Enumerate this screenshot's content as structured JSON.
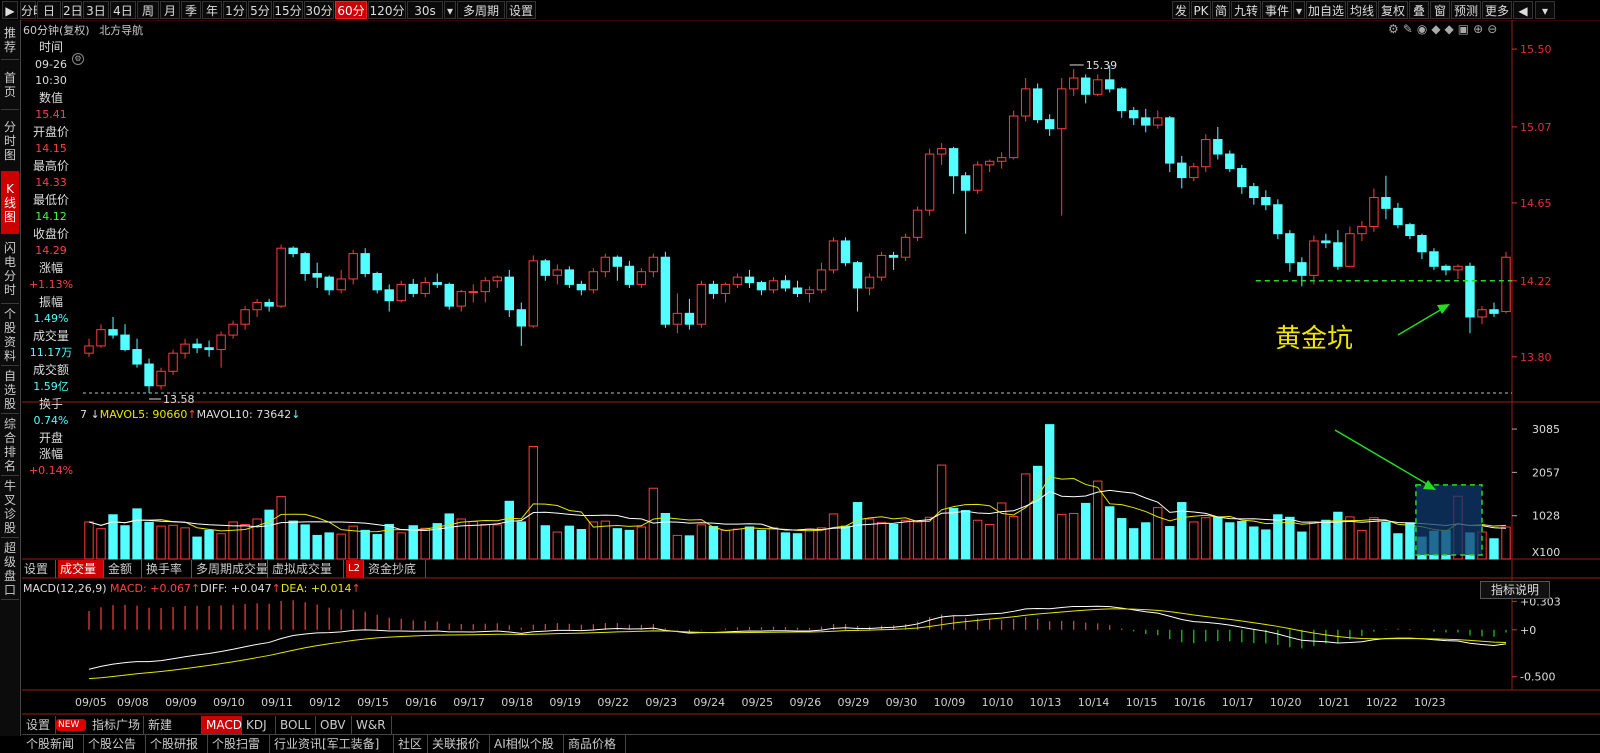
{
  "toolbar": {
    "left": [
      "分时",
      "日",
      "2日",
      "3日",
      "4日",
      "周",
      "月",
      "季",
      "年",
      "1分",
      "5分",
      "15分",
      "30分",
      "60分",
      "120分",
      "30s",
      "多周期",
      "设置"
    ],
    "active": "60分",
    "right": [
      "发",
      "PK",
      "简",
      "九转",
      "事件",
      "加自选",
      "均线",
      "复权",
      "叠",
      "窗",
      "预测",
      "更多"
    ]
  },
  "leftnav": [
    "推荐",
    "首页",
    "分时图",
    "K线图",
    "闪电分时",
    "个股资料",
    "自选股",
    "综合排名",
    "牛叉诊股",
    "超级盘口"
  ],
  "leftnav_active": "K线图",
  "header": {
    "period": "60分钟(复权)",
    "stock": "北方导航"
  },
  "info": {
    "time_label": "时间",
    "date": "09-26",
    "time": "10:30",
    "value_label": "数值",
    "value": "15.41",
    "open_label": "开盘价",
    "open": "14.15",
    "high_label": "最高价",
    "high": "14.33",
    "low_label": "最低价",
    "low": "14.12",
    "close_label": "收盘价",
    "close": "14.29",
    "change_label": "涨幅",
    "change": "+1.13%",
    "amplitude_label": "振幅",
    "amplitude": "1.49%",
    "volume_label": "成交量",
    "volume": "11.17万",
    "amount_label": "成交额",
    "amount": "1.59亿",
    "turnover_label": "换手",
    "turnover": "0.74%",
    "open_change_label1": "开盘",
    "open_change_label2": "涨幅",
    "open_change": "+0.14%"
  },
  "volume_legend": {
    "prefix": "7",
    "mavol5_label": "MAVOL5:",
    "mavol5": "90660",
    "mavol10_label": "MAVOL10:",
    "mavol10": "73642"
  },
  "macd_legend": {
    "title": "MACD(12,26,9)",
    "macd_label": "MACD:",
    "macd": "+0.067",
    "diff_label": "DIFF:",
    "diff": "+0.047",
    "dea_label": "DEA:",
    "dea": "+0.014"
  },
  "indicator_button": "指标说明",
  "tabs": [
    "设置",
    "成交量",
    "金额",
    "换手率",
    "多周期成交量",
    "虚拟成交量",
    "L2",
    "资金抄底"
  ],
  "tab_active": "成交量",
  "bottombar": [
    "设置",
    "NEW",
    "指标广场",
    "新建",
    "MACD",
    "KDJ",
    "BOLL",
    "OBV",
    "W&R"
  ],
  "bottombar_active": "MACD",
  "newsbar": [
    "个股新闻",
    "个股公告",
    "个股研报",
    "个股扫雷",
    "行业资讯[军工装备]",
    "社区",
    "关联报价",
    "AI相似个股",
    "商品价格"
  ],
  "annotation": {
    "text": "黄金坑",
    "color": "#f2e600",
    "arrow_color": "#22dd22",
    "line_color": "#22dd22"
  },
  "colors": {
    "up": "#ff3b3b",
    "down": "#54ffff",
    "ma5": "#e6e600",
    "ma10": "#ffffff",
    "axis_red": "#e03030",
    "date": "#d0d0d0"
  },
  "chart_data": [
    {
      "type": "candlestick",
      "yaxis": {
        "ticks": [
          15.5,
          15.07,
          14.65,
          14.22,
          13.8
        ],
        "ylim": [
          13.6,
          15.55
        ]
      },
      "x_date_labels": [
        "09/05",
        "09/08",
        "09/09",
        "09/10",
        "09/11",
        "09/12",
        "09/15",
        "09/16",
        "09/17",
        "09/18",
        "09/19",
        "09/22",
        "09/23",
        "09/24",
        "09/25",
        "09/26",
        "09/29",
        "09/30",
        "10/09",
        "10/10",
        "10/13",
        "10/14",
        "10/15",
        "10/16",
        "10/17",
        "10/20",
        "10/21",
        "10/22",
        "10/23"
      ],
      "bars_per_day": 4,
      "ohlc": [
        [
          13.82,
          13.9,
          13.8,
          13.86
        ],
        [
          13.86,
          13.98,
          13.85,
          13.95
        ],
        [
          13.95,
          14.02,
          13.9,
          13.92
        ],
        [
          13.92,
          13.98,
          13.83,
          13.84
        ],
        [
          13.84,
          13.9,
          13.74,
          13.76
        ],
        [
          13.76,
          13.79,
          13.6,
          13.64
        ],
        [
          13.64,
          13.74,
          13.62,
          13.72
        ],
        [
          13.72,
          13.84,
          13.7,
          13.82
        ],
        [
          13.82,
          13.9,
          13.79,
          13.87
        ],
        [
          13.87,
          13.9,
          13.82,
          13.85
        ],
        [
          13.85,
          13.89,
          13.8,
          13.84
        ],
        [
          13.84,
          13.94,
          13.74,
          13.92
        ],
        [
          13.92,
          14.0,
          13.9,
          13.98
        ],
        [
          13.98,
          14.08,
          13.95,
          14.06
        ],
        [
          14.06,
          14.12,
          14.02,
          14.1
        ],
        [
          14.1,
          14.12,
          14.05,
          14.08
        ],
        [
          14.08,
          14.42,
          14.07,
          14.4
        ],
        [
          14.4,
          14.41,
          14.35,
          14.37
        ],
        [
          14.37,
          14.38,
          14.22,
          14.26
        ],
        [
          14.26,
          14.32,
          14.18,
          14.24
        ],
        [
          14.24,
          14.25,
          14.14,
          14.17
        ],
        [
          14.17,
          14.28,
          14.15,
          14.23
        ],
        [
          14.23,
          14.39,
          14.2,
          14.37
        ],
        [
          14.37,
          14.4,
          14.24,
          14.26
        ],
        [
          14.26,
          14.27,
          14.15,
          14.17
        ],
        [
          14.17,
          14.2,
          14.05,
          14.11
        ],
        [
          14.11,
          14.22,
          14.1,
          14.2
        ],
        [
          14.2,
          14.23,
          14.13,
          14.15
        ],
        [
          14.15,
          14.24,
          14.13,
          14.21
        ],
        [
          14.21,
          14.26,
          14.18,
          14.2
        ],
        [
          14.2,
          14.21,
          14.06,
          14.08
        ],
        [
          14.08,
          14.17,
          14.05,
          14.16
        ],
        [
          14.16,
          14.2,
          14.1,
          14.16
        ],
        [
          14.16,
          14.24,
          14.1,
          14.22
        ],
        [
          14.22,
          14.25,
          14.18,
          14.24
        ],
        [
          14.24,
          14.28,
          14.02,
          14.06
        ],
        [
          14.06,
          14.1,
          13.86,
          13.97
        ],
        [
          13.97,
          14.36,
          13.96,
          14.33
        ],
        [
          14.33,
          14.34,
          14.22,
          14.25
        ],
        [
          14.25,
          14.31,
          14.2,
          14.28
        ],
        [
          14.28,
          14.3,
          14.18,
          14.2
        ],
        [
          14.2,
          14.22,
          14.14,
          14.17
        ],
        [
          14.17,
          14.29,
          14.15,
          14.27
        ],
        [
          14.27,
          14.37,
          14.24,
          14.35
        ],
        [
          14.35,
          14.36,
          14.22,
          14.3
        ],
        [
          14.3,
          14.33,
          14.18,
          14.2
        ],
        [
          14.2,
          14.29,
          14.18,
          14.27
        ],
        [
          14.27,
          14.37,
          14.24,
          14.35
        ],
        [
          14.35,
          14.38,
          13.96,
          13.98
        ],
        [
          13.98,
          14.15,
          13.93,
          14.04
        ],
        [
          14.04,
          14.12,
          13.95,
          13.98
        ],
        [
          13.98,
          14.22,
          13.96,
          14.2
        ],
        [
          14.2,
          14.22,
          14.12,
          14.15
        ],
        [
          14.15,
          14.21,
          14.1,
          14.2
        ],
        [
          14.2,
          14.26,
          14.18,
          14.24
        ],
        [
          14.24,
          14.28,
          14.18,
          14.21
        ],
        [
          14.21,
          14.22,
          14.14,
          14.17
        ],
        [
          14.17,
          14.24,
          14.15,
          14.22
        ],
        [
          14.22,
          14.25,
          14.16,
          14.18
        ],
        [
          14.18,
          14.22,
          14.13,
          14.15
        ],
        [
          14.15,
          14.19,
          14.1,
          14.17
        ],
        [
          14.17,
          14.32,
          14.15,
          14.28
        ],
        [
          14.28,
          14.46,
          14.26,
          14.44
        ],
        [
          14.44,
          14.46,
          14.3,
          14.32
        ],
        [
          14.32,
          14.33,
          14.05,
          14.18
        ],
        [
          14.18,
          14.26,
          14.14,
          14.24
        ],
        [
          14.24,
          14.38,
          14.22,
          14.36
        ],
        [
          14.36,
          14.38,
          14.28,
          14.35
        ],
        [
          14.35,
          14.48,
          14.33,
          14.46
        ],
        [
          14.46,
          14.63,
          14.44,
          14.61
        ],
        [
          14.61,
          14.95,
          14.58,
          14.92
        ],
        [
          14.92,
          14.98,
          14.86,
          14.95
        ],
        [
          14.95,
          14.96,
          14.7,
          14.8
        ],
        [
          14.8,
          14.82,
          14.48,
          14.72
        ],
        [
          14.72,
          14.88,
          14.7,
          14.86
        ],
        [
          14.86,
          14.89,
          14.82,
          14.88
        ],
        [
          14.88,
          14.93,
          14.84,
          14.9
        ],
        [
          14.9,
          15.16,
          14.89,
          15.13
        ],
        [
          15.13,
          15.34,
          15.1,
          15.28
        ],
        [
          15.28,
          15.31,
          15.09,
          15.11
        ],
        [
          15.11,
          15.14,
          15.02,
          15.06
        ],
        [
          15.06,
          15.34,
          14.58,
          15.28
        ],
        [
          15.28,
          15.39,
          15.24,
          15.34
        ],
        [
          15.34,
          15.36,
          15.2,
          15.25
        ],
        [
          15.25,
          15.36,
          15.24,
          15.33
        ],
        [
          15.33,
          15.41,
          15.26,
          15.28
        ],
        [
          15.28,
          15.29,
          15.12,
          15.16
        ],
        [
          15.16,
          15.18,
          15.08,
          15.12
        ],
        [
          15.12,
          15.17,
          15.04,
          15.08
        ],
        [
          15.08,
          15.16,
          15.06,
          15.12
        ],
        [
          15.12,
          15.13,
          14.82,
          14.87
        ],
        [
          14.87,
          14.91,
          14.73,
          14.79
        ],
        [
          14.79,
          14.87,
          14.77,
          14.85
        ],
        [
          14.85,
          15.03,
          14.82,
          15.0
        ],
        [
          15.0,
          15.07,
          14.89,
          14.92
        ],
        [
          14.92,
          14.94,
          14.82,
          14.84
        ],
        [
          14.84,
          14.86,
          14.7,
          14.74
        ],
        [
          14.74,
          14.76,
          14.64,
          14.68
        ],
        [
          14.68,
          14.72,
          14.61,
          14.64
        ],
        [
          14.64,
          14.67,
          14.45,
          14.48
        ],
        [
          14.48,
          14.5,
          14.27,
          14.32
        ],
        [
          14.32,
          14.35,
          14.19,
          14.25
        ],
        [
          14.25,
          14.47,
          14.2,
          14.44
        ],
        [
          14.44,
          14.48,
          14.4,
          14.43
        ],
        [
          14.43,
          14.5,
          14.28,
          14.3
        ],
        [
          14.3,
          14.52,
          14.3,
          14.48
        ],
        [
          14.48,
          14.55,
          14.44,
          14.52
        ],
        [
          14.52,
          14.73,
          14.49,
          14.68
        ],
        [
          14.68,
          14.8,
          14.56,
          14.62
        ],
        [
          14.62,
          14.65,
          14.51,
          14.53
        ],
        [
          14.53,
          14.54,
          14.45,
          14.47
        ],
        [
          14.47,
          14.48,
          14.34,
          14.38
        ],
        [
          14.38,
          14.4,
          14.28,
          14.3
        ],
        [
          14.3,
          14.31,
          14.25,
          14.28
        ],
        [
          14.28,
          14.31,
          14.23,
          14.3
        ],
        [
          14.3,
          14.32,
          13.93,
          14.02
        ],
        [
          14.02,
          14.08,
          13.98,
          14.06
        ],
        [
          14.06,
          14.1,
          14.02,
          14.04
        ],
        [
          14.05,
          14.38,
          14.04,
          14.35
        ]
      ],
      "annotations": [
        {
          "text": "15.39",
          "x_index": 82,
          "value": 15.39
        },
        {
          "text": "13.58",
          "x_index": 5,
          "value": 13.6
        }
      ],
      "support_line": 14.22
    },
    {
      "type": "bar",
      "name": "成交量",
      "yaxis": {
        "ticks": [
          3085,
          2057,
          1028
        ],
        "unit_label": "X100",
        "ylim": [
          0,
          3300
        ]
      },
      "values": [
        880,
        720,
        1050,
        790,
        1190,
        870,
        780,
        800,
        740,
        520,
        680,
        600,
        880,
        820,
        950,
        1160,
        1480,
        900,
        810,
        560,
        620,
        590,
        780,
        680,
        580,
        820,
        620,
        790,
        730,
        840,
        1070,
        950,
        890,
        820,
        810,
        1370,
        880,
        2670,
        790,
        640,
        780,
        700,
        880,
        900,
        720,
        680,
        760,
        1680,
        1080,
        560,
        550,
        810,
        770,
        680,
        710,
        760,
        680,
        740,
        620,
        600,
        710,
        740,
        1070,
        780,
        1340,
        950,
        870,
        820,
        920,
        880,
        990,
        2230,
        1200,
        1150,
        920,
        820,
        1330,
        1010,
        2020,
        2200,
        3190,
        1060,
        1080,
        1320,
        1850,
        1240,
        960,
        720,
        860,
        1220,
        770,
        1340,
        880,
        980,
        1000,
        860,
        890,
        760,
        690,
        1050,
        990,
        640,
        880,
        920,
        1110,
        1000,
        680,
        980,
        870,
        600,
        860,
        520,
        660,
        680,
        1490,
        620,
        640,
        480,
        760
      ]
    },
    {
      "type": "macd",
      "yaxis": {
        "ticks": [
          "+0.303",
          "+0",
          "-0.500"
        ],
        "ylim": [
          -0.62,
          0.36
        ]
      },
      "diff_start": -0.42,
      "dea_start": -0.52
    }
  ]
}
